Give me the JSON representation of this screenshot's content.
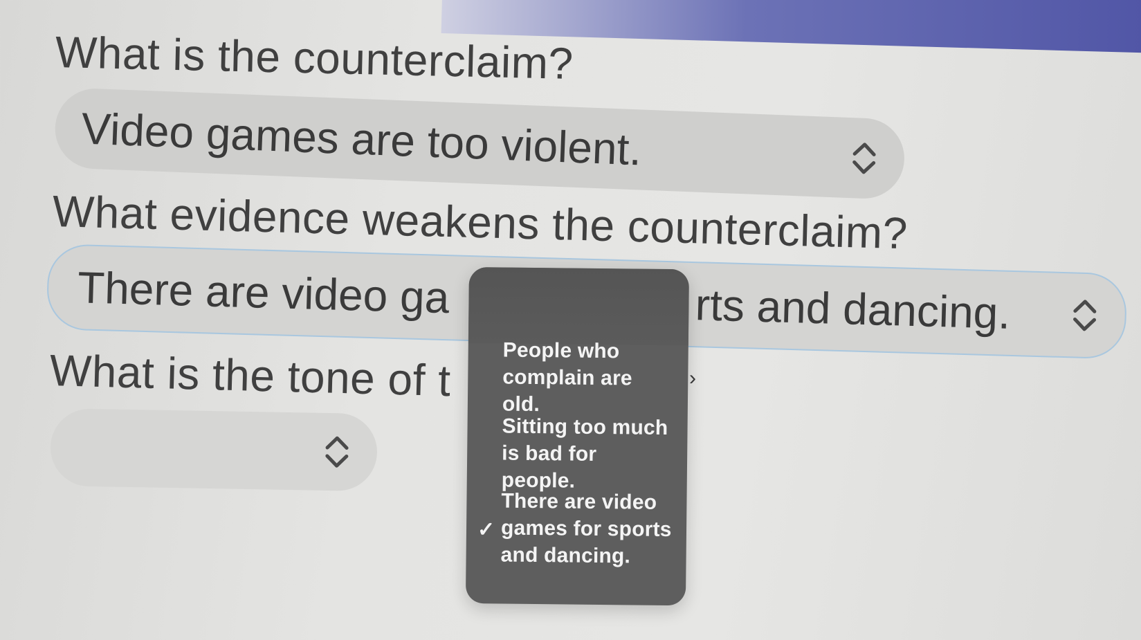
{
  "questions": {
    "q1": "What is the counterclaim?",
    "q2": "What evidence weakens the counterclaim?",
    "q3": "What is the tone of t"
  },
  "selects": {
    "counterclaim": "Video games are too violent.",
    "evidence_left": "There are video ga",
    "evidence_right": "rts and dancing.",
    "tone": ""
  },
  "menu": {
    "options": [
      "People who complain are old.",
      "Sitting too much is bad for people.",
      "There are video games for sports and dancing."
    ],
    "selected_index": 2,
    "check_glyph": "✓"
  },
  "icons": {
    "select_chevron": "chevron-up-down-icon",
    "selected_mark": "checkmark-icon"
  },
  "colors": {
    "accent_bar": "#4d52a4",
    "menu_bg": "#5e5e5e",
    "focus_border": "#a9c7df"
  }
}
